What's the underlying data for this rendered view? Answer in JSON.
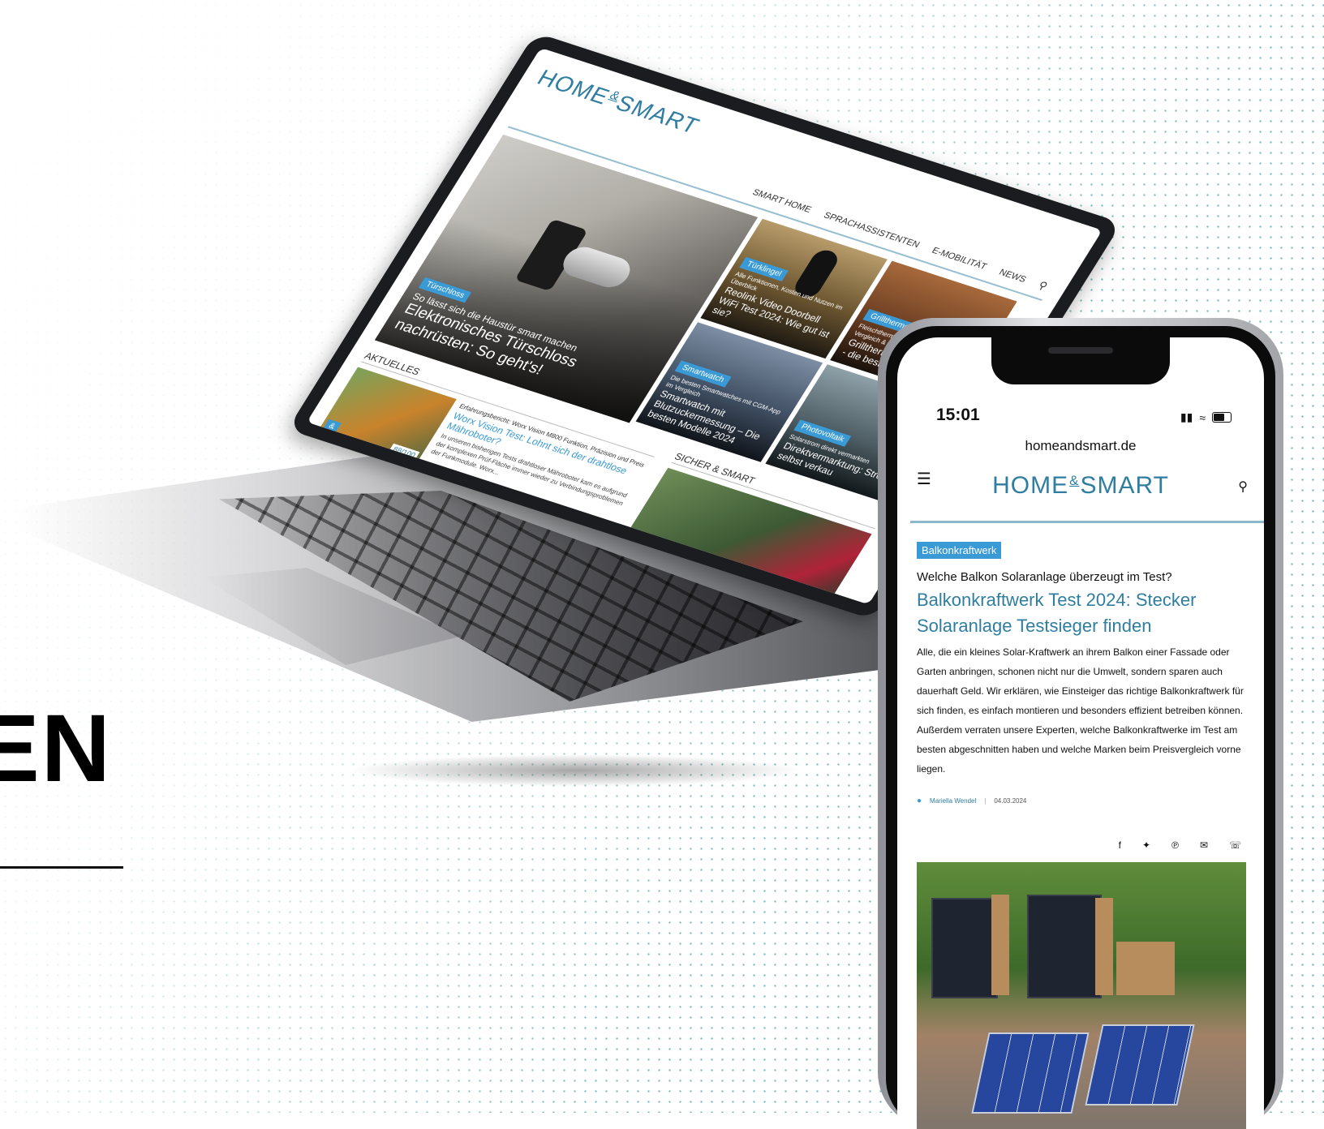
{
  "left_text": {
    "word": "EN"
  },
  "laptop": {
    "logo": {
      "part1": "HOME",
      "amp": "&",
      "part2": "SMART"
    },
    "nav": [
      "SMART HOME",
      "SPRACHASSISTENTEN",
      "E-MOBILITÄT",
      "NEWS"
    ],
    "hero": {
      "tag": "Türschloss",
      "subtitle": "So lässt sich die Haustür smart machen",
      "title": "Elektronisches Türschloss nachrüsten: So geht's!"
    },
    "tiles": [
      {
        "tag": "Türklingel",
        "subtitle": "Alle Funktionen, Kosten und Nutzen im Überblick",
        "title": "Reolink Video Doorbell WiFi Test 2024: Wie gut ist sie?"
      },
      {
        "tag": "Grillthermometer",
        "subtitle": "Fleischthermometer zum Grillen: Tests, Vergleich & Bewertungen",
        "title": "Grillthermometer im Check - die besten"
      },
      {
        "tag": "Smartwatch",
        "subtitle": "Die besten Smartwatches mit CGM-App im Vergleich",
        "title": "Smartwatch mit Blutzuckermessung – Die besten Modelle 2024"
      },
      {
        "tag": "Photovoltaik",
        "subtitle": "Solarstrom direkt vermarkten",
        "title": "Direktvermarktung: Strom selbst verkau"
      }
    ],
    "sections": {
      "aktuelles": "AKTUELLES",
      "sicher": "SICHER & SMART"
    },
    "news": {
      "score": "88/100",
      "kicker": "Erfahrungsbericht: Worx Vision M800 Funktion, Präzision und Preis",
      "headline": "Worx Vision Test: Lohnt sich der drahtlose Mähroboter?",
      "teaser": "In unseren bisherigen Tests drahtloser Mähroboter kam es aufgrund der komplexen Prüf-Fläche immer wieder zu Verbindungsproblemen der Funkmodule. Worx..."
    }
  },
  "phone": {
    "time": "15:01",
    "url": "homeandsmart.de",
    "logo": {
      "part1": "HOME",
      "amp": "&",
      "part2": "SMART"
    },
    "article": {
      "tag": "Balkonkraftwerk",
      "kicker": "Welche Balkon Solaranlage überzeugt im Test?",
      "headline": "Balkonkraftwerk Test 2024: Stecker Solaranlage Testsieger finden",
      "body": "Alle, die ein kleines Solar-Kraftwerk an ihrem Balkon einer Fassade oder Garten anbringen, schonen nicht nur die Umwelt, sondern sparen auch dauerhaft Geld. Wir erklären, wie Einsteiger das richtige Balkonkraftwerk für sich finden, es einfach montieren und besonders effizient betreiben können. Außerdem verraten unsere Experten, welche Balkonkraftwerke im Test am besten abgeschnitten haben und welche Marken beim Preisvergleich vorne liegen.",
      "author": "Mariella Wendel",
      "divider": "|",
      "date": "04.03.2024"
    },
    "share_icons": [
      "facebook-icon",
      "twitter-icon",
      "pinterest-icon",
      "mail-icon",
      "whatsapp-icon"
    ]
  },
  "colors": {
    "brand": "#2f7ea1",
    "tag": "#3a9ad6",
    "dots": "#6fb8b3"
  }
}
